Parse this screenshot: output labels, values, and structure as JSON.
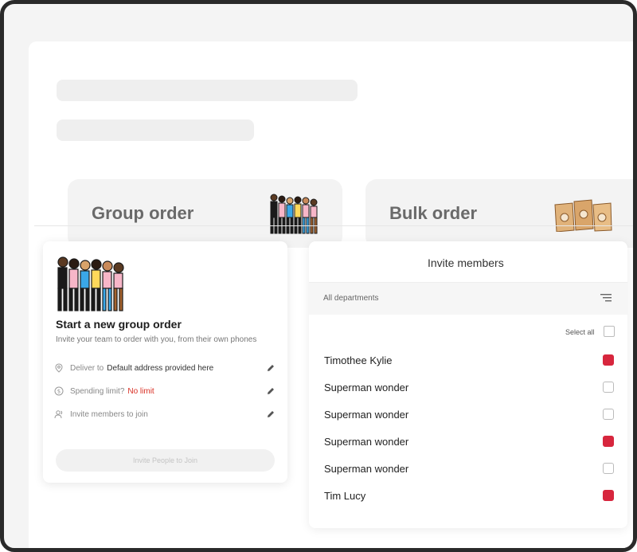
{
  "cards": {
    "group_order": "Group order",
    "bulk_order": "Bulk order"
  },
  "group_card": {
    "title": "Start a new group order",
    "subtitle": "Invite your team to order with you, from their own phones",
    "deliver_label": "Deliver to",
    "deliver_value": "Default address provided here",
    "spending_label": "Spending limit?",
    "spending_value": "No limit",
    "invite_label": "Invite members to join",
    "invite_button": "Invite People to Join",
    "icons": [
      "location-pin-icon",
      "dollar-icon",
      "people-icon",
      "pencil-icon"
    ]
  },
  "invite": {
    "title": "Invite members",
    "department_filter": "All departments",
    "select_all": "Select all",
    "members": [
      {
        "name": "Timothee Kylie",
        "checked": true
      },
      {
        "name": "Superman wonder",
        "checked": false
      },
      {
        "name": "Superman wonder",
        "checked": false
      },
      {
        "name": "Superman wonder",
        "checked": true
      },
      {
        "name": "Superman wonder",
        "checked": false
      },
      {
        "name": "Tim Lucy",
        "checked": true
      }
    ]
  },
  "colors": {
    "accent": "#d7263d",
    "limit_text": "#d93025",
    "card_bg": "#f3f3f3"
  }
}
